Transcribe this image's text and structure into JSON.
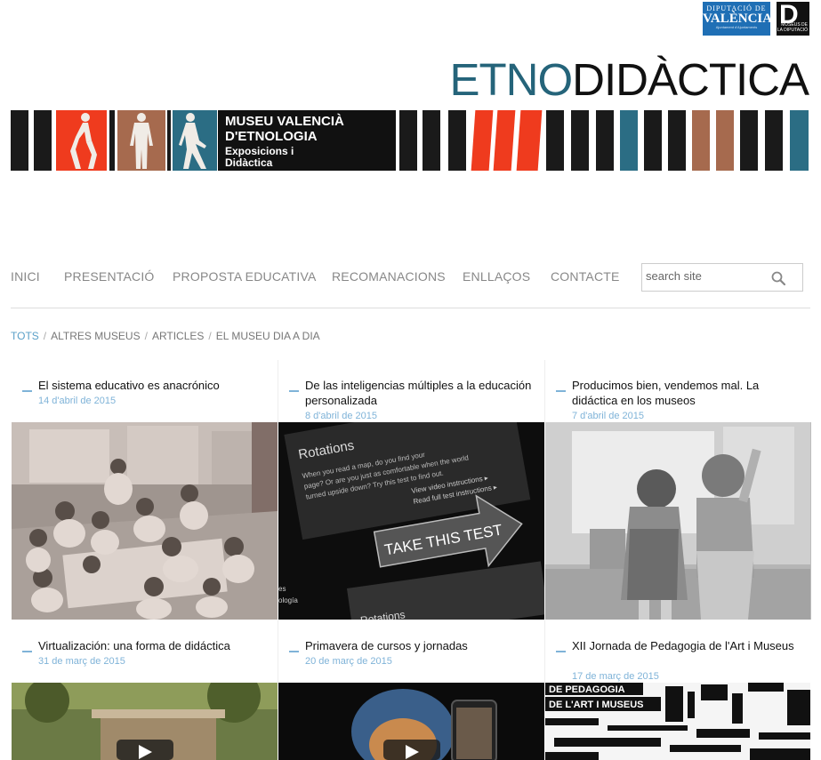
{
  "logos": {
    "dipu_line1": "DIPUTACIÓ DE",
    "dipu_line2": "VALÈNCIA",
    "dipu_line3": "Ajuntament d'Ajuntaments",
    "museus_big": "D",
    "museus_line": "MUSEUS DE LA DIPUTACIÓ"
  },
  "site": {
    "title_part1": "ETNO",
    "title_part2": "DIDÀCTICA",
    "accent": "#25647a"
  },
  "banner": {
    "line1a": "MUSEU VALENCIÀ",
    "line1b": "D'ETNOLOGIA",
    "line2a": "Exposicions i",
    "line2b": "Didàctica",
    "colors": {
      "black": "#1a1a1a",
      "red": "#ef3b1e",
      "brown": "#a66a4e",
      "teal": "#2b6d84",
      "white_figure": "#f0ece6"
    }
  },
  "nav": {
    "items": [
      "INICI",
      "PRESENTACIÓ",
      "PROPOSTA EDUCATIVA",
      "RECOMANACIONS",
      "ENLLAÇOS",
      "CONTACTE"
    ],
    "search_placeholder": "search site"
  },
  "filter": {
    "items": [
      "TOTS",
      "ALTRES MUSEUS",
      "ARTICLES",
      "EL MUSEU DIA A DIA"
    ],
    "active": "TOTS",
    "separator": "/"
  },
  "posts": [
    {
      "title": "El sistema educativo es anacrónico",
      "date": "14 d'abril de 2015",
      "image": "children-drawing-photo"
    },
    {
      "title": "De las inteligencias múltiples a la educación personalizada",
      "date": "8 d'abril de 2015",
      "image": "rotations-test-screen"
    },
    {
      "title": "Producimos bien, vendemos mal. La didáctica en los museos",
      "date": "7 d'abril de 2015",
      "image": "girls-at-wall-photo"
    },
    {
      "title": "Virtualización: una forma de didáctica",
      "date": "31 de març de 2015",
      "image": "building-video"
    },
    {
      "title": "Primavera de cursos y jornadas",
      "date": "20 de març de 2015",
      "image": "phone-painting-video"
    },
    {
      "title": "XII Jornada de Pedagogia de l'Art i Museus",
      "date": "17 de març de 2015",
      "image": "jornada-poster"
    }
  ],
  "image_text": {
    "rot_header": "Rotations",
    "rot_body1": "When you read a map, do you find your",
    "rot_body2": "page? Or are you just as comfortable when the world",
    "rot_body3": "turned upside down? Try this test to find out.",
    "rot_link1": "View video instructions ▸",
    "rot_link2": "Read full test instructions ▸",
    "rot_button": "TAKE THIS TEST",
    "rot_footer": "Rotations",
    "rot_side1": "es",
    "rot_side2": "ología",
    "poster1": "DE PEDAGOGIA",
    "poster2": "DE L'ART I MUSEUS"
  }
}
